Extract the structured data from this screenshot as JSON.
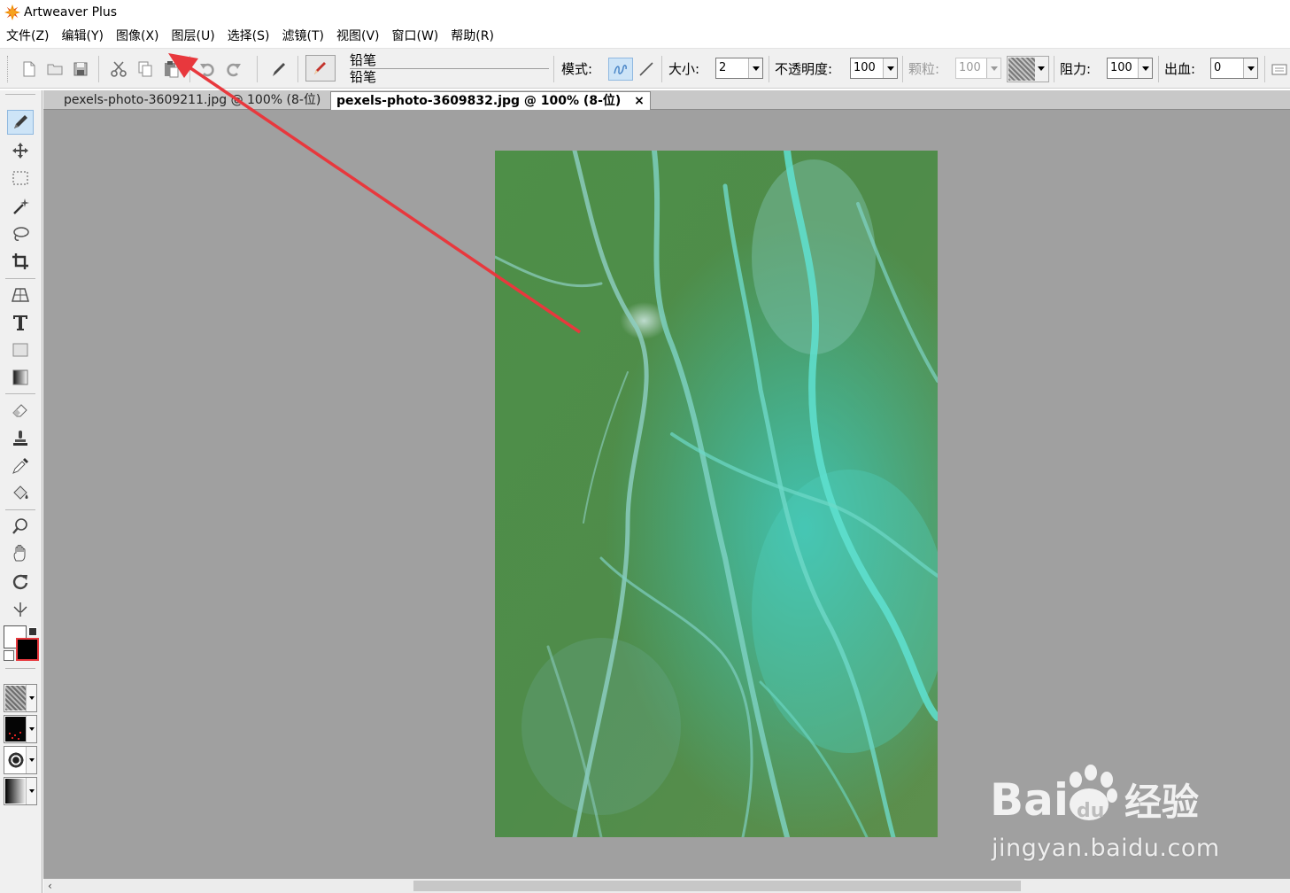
{
  "window": {
    "title": "Artweaver Plus",
    "icon": "artweaver-logo-icon"
  },
  "menu": [
    "文件(Z)",
    "编辑(Y)",
    "图像(X)",
    "图层(U)",
    "选择(S)",
    "滤镜(T)",
    "视图(V)",
    "窗口(W)",
    "帮助(R)"
  ],
  "toolbar": {
    "file_icons": [
      "new-file-icon",
      "open-folder-icon",
      "save-icon"
    ],
    "edit_icons": [
      "cut-icon",
      "copy-icon",
      "paste-icon",
      "undo-icon",
      "redo-icon"
    ],
    "brush_name_line1": "铅笔",
    "brush_name_line2": "铅笔",
    "mode_label": "模式:",
    "size_label": "大小:",
    "size_value": "2",
    "opacity_label": "不透明度:",
    "opacity_value": "100",
    "grain_label": "颗粒:",
    "grain_value": "100",
    "resist_label": "阻力:",
    "resist_value": "100",
    "bleed_label": "出血:",
    "bleed_value": "0"
  },
  "tabs": [
    {
      "label": "pexels-photo-3609211.jpg @ 100% (8-位)",
      "active": false
    },
    {
      "label": "pexels-photo-3609832.jpg @ 100% (8-位)",
      "active": true,
      "close": "×"
    }
  ],
  "tools": [
    "pencil-icon",
    "move-icon",
    "rect-select-icon",
    "magic-wand-icon",
    "lasso-icon",
    "crop-icon",
    "perspective-icon",
    "text-icon",
    "shape-icon",
    "gradient-icon",
    "eraser-icon",
    "stamp-icon",
    "eyedropper-icon",
    "paint-bucket-icon",
    "zoom-icon",
    "hand-icon",
    "rotate-icon",
    "symmetry-icon"
  ],
  "colors": {
    "foreground": "#000000",
    "background": "#ffffff",
    "accent": "#e8383d",
    "canvas_bg": "#a0a0a0"
  },
  "watermark": {
    "brand": "Bai du 经验",
    "url": "jingyan.baidu.com"
  }
}
